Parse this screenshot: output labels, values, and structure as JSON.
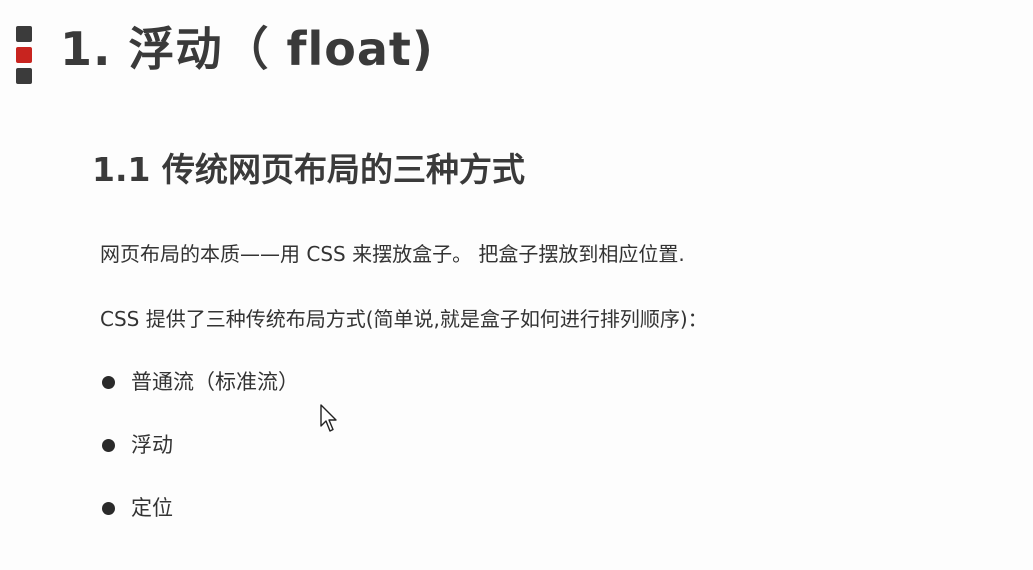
{
  "slide": {
    "title": "1. 浮动（ float)",
    "subtitle": "1.1 传统网页布局的三种方式",
    "paragraphs": [
      "网页布局的本质——用 CSS 来摆放盒子。 把盒子摆放到相应位置.",
      "CSS 提供了三种传统布局方式(简单说,就是盒子如何进行排列顺序)："
    ],
    "bullets": [
      "普通流（标准流）",
      "浮动",
      "定位"
    ]
  },
  "colors": {
    "marker_dark": "#3b3b3b",
    "marker_accent": "#c8241f",
    "heading": "#3a3a3a",
    "text": "#333333"
  },
  "icons": {
    "marker": "square-marker-icon",
    "cursor": "mouse-pointer-icon",
    "bullet": "bullet-dot-icon"
  }
}
